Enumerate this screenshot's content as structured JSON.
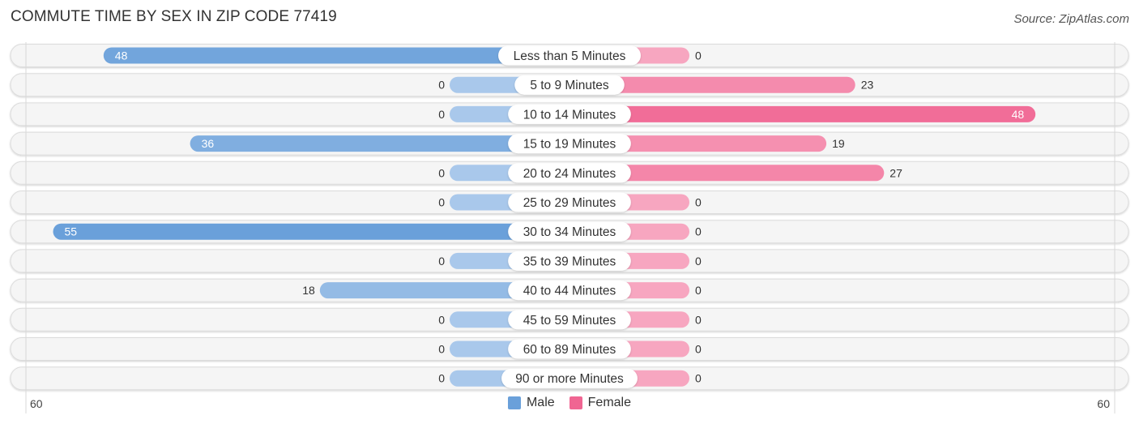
{
  "title": "COMMUTE TIME BY SEX IN ZIP CODE 77419",
  "source": "Source: ZipAtlas.com",
  "colors": {
    "male": "#6aa0da",
    "male_light": "#a9c8eb",
    "female": "#f06592",
    "female_light": "#f7a6c0",
    "row_bg": "#f3f3f3"
  },
  "chart_data": {
    "type": "bar",
    "orientation": "horizontal-diverging",
    "title": "COMMUTE TIME BY SEX IN ZIP CODE 77419",
    "categories": [
      "Less than 5 Minutes",
      "5 to 9 Minutes",
      "10 to 14 Minutes",
      "15 to 19 Minutes",
      "20 to 24 Minutes",
      "25 to 29 Minutes",
      "30 to 34 Minutes",
      "35 to 39 Minutes",
      "40 to 44 Minutes",
      "45 to 59 Minutes",
      "60 to 89 Minutes",
      "90 or more Minutes"
    ],
    "series": [
      {
        "name": "Male",
        "values": [
          48,
          0,
          0,
          36,
          0,
          0,
          55,
          0,
          18,
          0,
          0,
          0
        ]
      },
      {
        "name": "Female",
        "values": [
          0,
          23,
          48,
          19,
          27,
          0,
          0,
          0,
          0,
          0,
          0,
          0
        ]
      }
    ],
    "xlim": [
      -60,
      60
    ],
    "axis_labels": {
      "left": "60",
      "right": "60"
    },
    "legend": {
      "position": "bottom-center",
      "entries": [
        "Male",
        "Female"
      ]
    }
  }
}
